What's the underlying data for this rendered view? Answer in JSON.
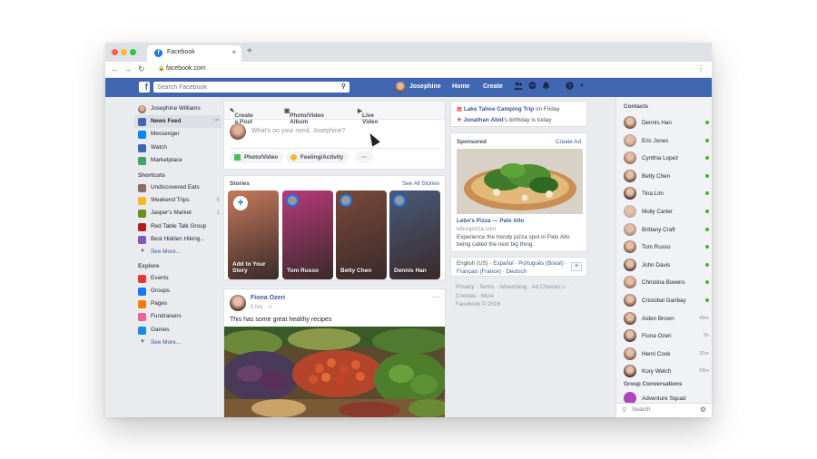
{
  "browser": {
    "tab_title": "Facebook",
    "tab_close": "×",
    "new_tab": "+",
    "url": "facebook.com",
    "back": "←",
    "forward": "→",
    "reload": "↻",
    "lock": "🔒",
    "menu": "⋮"
  },
  "topbar": {
    "logo": "f",
    "search_placeholder": "Search Facebook",
    "user_name": "Josephine",
    "home_label": "Home",
    "create_label": "Create",
    "brand_color": "#4267b2"
  },
  "left_nav": {
    "profile_name": "Josephine Williams",
    "main": [
      {
        "label": "News Feed",
        "icon": "news-feed-icon",
        "color": "#4267b2"
      },
      {
        "label": "Messenger",
        "icon": "messenger-icon",
        "color": "#0084ff"
      },
      {
        "label": "Watch",
        "icon": "watch-icon",
        "color": "#4267b2"
      },
      {
        "label": "Marketplace",
        "icon": "marketplace-icon",
        "color": "#42a46c"
      }
    ],
    "shortcuts_heading": "Shortcuts",
    "shortcuts": [
      {
        "label": "Undiscovered Eats",
        "count": "",
        "color": "#8d6e63"
      },
      {
        "label": "Weekend Trips",
        "count": "5",
        "color": "#f7b928"
      },
      {
        "label": "Jasper's Market",
        "count": "1",
        "color": "#6b8e23"
      },
      {
        "label": "Red Table Talk Group",
        "count": "",
        "color": "#b71c1c"
      },
      {
        "label": "Best Hidden Hiking...",
        "count": "",
        "color": "#7e57c2"
      }
    ],
    "see_more": "See More...",
    "explore_heading": "Explore",
    "explore": [
      {
        "label": "Events",
        "color": "#e53935"
      },
      {
        "label": "Groups",
        "color": "#1877f2"
      },
      {
        "label": "Pages",
        "color": "#f57c00"
      },
      {
        "label": "Fundraisers",
        "color": "#f06292"
      },
      {
        "label": "Games",
        "color": "#1e88e5"
      }
    ],
    "explore_more": "See More..."
  },
  "composer": {
    "tabs": [
      "Create a Post",
      "Photo/Video Album",
      "Live Video"
    ],
    "placeholder": "What's on your mind, Josephine?",
    "actions": [
      "Photo/Video",
      "Feeling/Activity"
    ],
    "more": "···"
  },
  "stories": {
    "heading": "Stories",
    "see_all": "See All Stories",
    "items": [
      {
        "name": "Add to Your Story",
        "type": "add",
        "color": "#c47a5a"
      },
      {
        "name": "Tom Russo",
        "type": "friend",
        "color": "#b73a7a"
      },
      {
        "name": "Betty Chen",
        "type": "friend",
        "color": "#7a4a3a"
      },
      {
        "name": "Dennis Han",
        "type": "friend",
        "color": "#4a5a7a"
      }
    ],
    "add_glyph": "+"
  },
  "post": {
    "author": "Fiona Ozeri",
    "time": "5 hrs ·",
    "text": "This has some great healthy recipes",
    "menu": "···"
  },
  "events": {
    "event_title": "Lake Tahoe Camping Trip",
    "event_when": "on Friday",
    "birthday_name": "Jonathan Abid",
    "birthday_text": "'s birthday is today"
  },
  "sponsored": {
    "heading": "Sponsored",
    "create_ad": "Create Ad",
    "ad_title": "Lebo's Pizza — Palo Alto",
    "ad_url": "lebospizza.com",
    "ad_desc": "Experience the trendy pizza spot in Palo Alto being called the next big thing."
  },
  "languages": {
    "current": "English (US)",
    "others": [
      "Español",
      "Português (Brasil)",
      "Français (France)",
      "Deutsch"
    ],
    "add": "+"
  },
  "footer": {
    "links": [
      "Privacy",
      "Terms",
      "Advertising",
      "Ad Choices",
      "Cookies",
      "More"
    ],
    "copyright": "Facebook © 2016"
  },
  "contacts": {
    "heading": "Contacts",
    "people": [
      {
        "name": "Dennis Han",
        "status": "online",
        "ago": "",
        "color": "#6d4c41"
      },
      {
        "name": "Eric Jones",
        "status": "online",
        "ago": "",
        "color": "#a1887f"
      },
      {
        "name": "Cynthia Lopez",
        "status": "online",
        "ago": "",
        "color": "#8d6e63"
      },
      {
        "name": "Betty Chen",
        "status": "online",
        "ago": "",
        "color": "#5d4037"
      },
      {
        "name": "Tina Lim",
        "status": "online",
        "ago": "",
        "color": "#3e2723"
      },
      {
        "name": "Molly Carter",
        "status": "online",
        "ago": "",
        "color": "#bcaaa4"
      },
      {
        "name": "Brittany Craft",
        "status": "online",
        "ago": "",
        "color": "#a1887f"
      },
      {
        "name": "Tom Russo",
        "status": "online",
        "ago": "",
        "color": "#795548"
      },
      {
        "name": "John Davis",
        "status": "online",
        "ago": "",
        "color": "#4e342e"
      },
      {
        "name": "Christina Bowers",
        "status": "online",
        "ago": "",
        "color": "#8d6e63"
      },
      {
        "name": "Cristobal Garibay",
        "status": "online",
        "ago": "",
        "color": "#6d4c41"
      },
      {
        "name": "Aiden Brown",
        "status": "away",
        "ago": "49m",
        "color": "#5d4037"
      },
      {
        "name": "Fiona Ozeri",
        "status": "away",
        "ago": "2h",
        "color": "#4e342e"
      },
      {
        "name": "Henri Cook",
        "status": "away",
        "ago": "20m",
        "color": "#795548"
      },
      {
        "name": "Kory Welch",
        "status": "away",
        "ago": "58m",
        "color": "#3e2723"
      }
    ],
    "group_heading": "Group Conversations",
    "group_first": "Adventure Squad",
    "search_placeholder": "Search"
  }
}
